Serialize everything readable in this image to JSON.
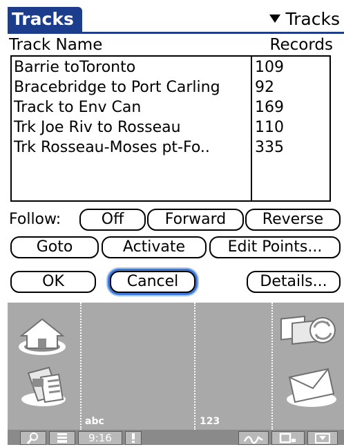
{
  "window": {
    "title": "Tracks",
    "menu_label": "Tracks"
  },
  "table": {
    "columns": [
      "Track Name",
      "Records"
    ],
    "rows": [
      {
        "name": "Barrie toToronto",
        "records": "109"
      },
      {
        "name": "Bracebridge to Port Carling",
        "records": "92"
      },
      {
        "name": "Track to Env Can",
        "records": "169"
      },
      {
        "name": "Trk Joe Riv to Rosseau",
        "records": "110"
      },
      {
        "name": "Trk Rosseau-Moses pt-Fo..",
        "records": "335"
      }
    ]
  },
  "follow": {
    "label": "Follow:",
    "options": [
      "Off",
      "Forward",
      "Reverse"
    ]
  },
  "actions": {
    "goto": "Goto",
    "activate": "Activate",
    "edit_points": "Edit Points..."
  },
  "dialog": {
    "ok": "OK",
    "cancel": "Cancel",
    "details": "Details..."
  },
  "graffiti": {
    "abc_label": "abc",
    "num_label": "123",
    "icons": [
      "home-icon",
      "calculator-icon",
      "sync-icon",
      "mail-icon"
    ]
  },
  "statusbar": {
    "time": "9:16",
    "icons": [
      "search-icon",
      "menu-icon",
      "alert-icon",
      "graffiti-icon",
      "screen-icon",
      "input-icon"
    ]
  },
  "colors": {
    "title_bg": "#1c3c8c",
    "cancel_focus": "#3c78d8",
    "graffiti_bg": "#a9a9a9"
  }
}
